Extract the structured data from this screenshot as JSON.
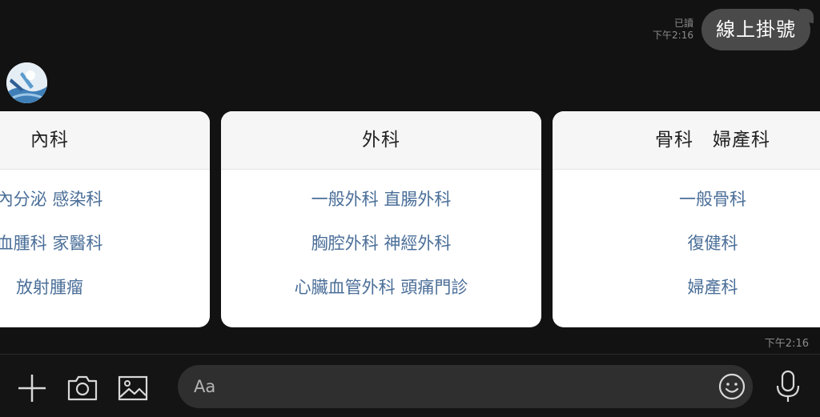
{
  "outgoing": {
    "read_status": "已讀",
    "time": "下午2:16",
    "text": "線上掛號"
  },
  "cards": [
    {
      "title": "內科",
      "items": [
        "內分泌 感染科",
        "血腫科 家醫科",
        "放射腫瘤"
      ]
    },
    {
      "title": "外科",
      "items": [
        "一般外科 直腸外科",
        "胸腔外科 神經外科",
        "心臟血管外科 頭痛門診"
      ]
    },
    {
      "title": "骨科　婦產科",
      "items": [
        "一般骨科",
        "復健科",
        "婦產科"
      ]
    }
  ],
  "received_time": "下午2:16",
  "input": {
    "placeholder": "Aa"
  },
  "icons": {
    "plus": "plus-icon",
    "camera": "camera-icon",
    "image": "image-icon",
    "emoji": "emoji-icon",
    "mic": "microphone-icon"
  },
  "colors": {
    "background": "#121212",
    "bubble": "#4a4a4a",
    "link_text": "#4a6e98",
    "card_header": "#f6f6f6"
  }
}
